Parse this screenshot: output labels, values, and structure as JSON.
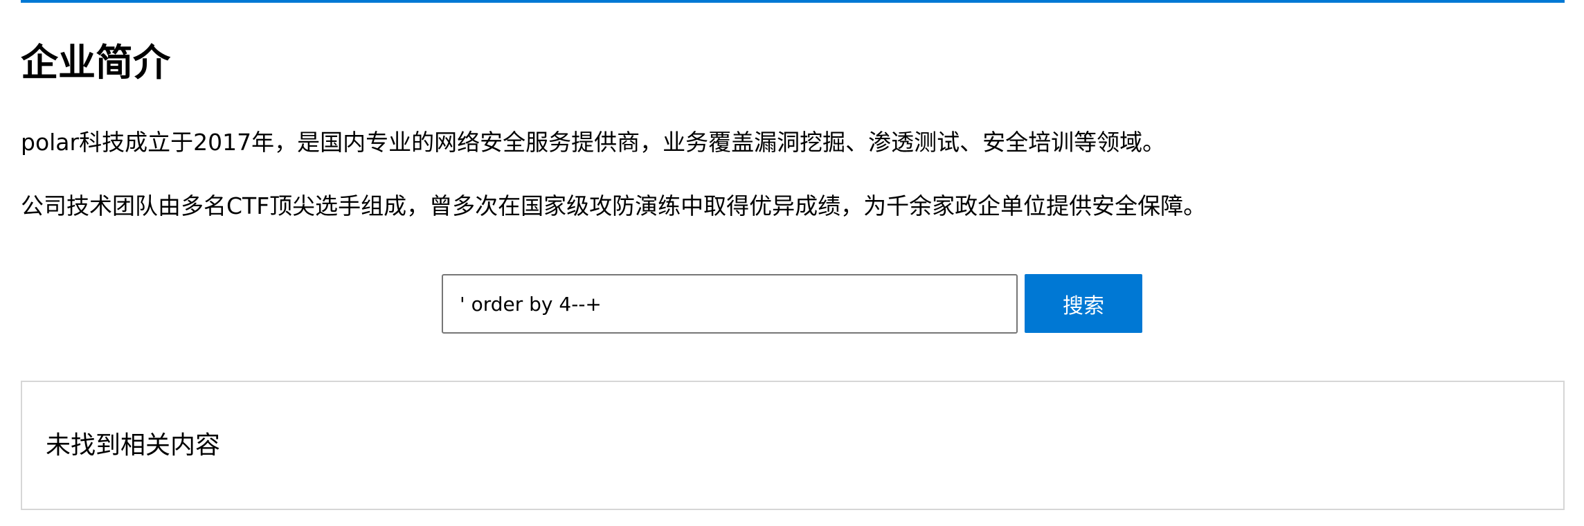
{
  "page": {
    "title": "企业简介",
    "paragraphs": [
      "polar科技成立于2017年，是国内专业的网络安全服务提供商，业务覆盖漏洞挖掘、渗透测试、安全培训等领域。",
      "公司技术团队由多名CTF顶尖选手组成，曾多次在国家级攻防演练中取得优异成绩，为千余家政企单位提供安全保障。"
    ]
  },
  "search": {
    "value": "' order by 4--+",
    "button_label": "搜索"
  },
  "result": {
    "message": "未找到相关内容"
  },
  "colors": {
    "accent": "#0078d4",
    "panel_border": "#d6d6d6",
    "input_border": "#767676"
  }
}
